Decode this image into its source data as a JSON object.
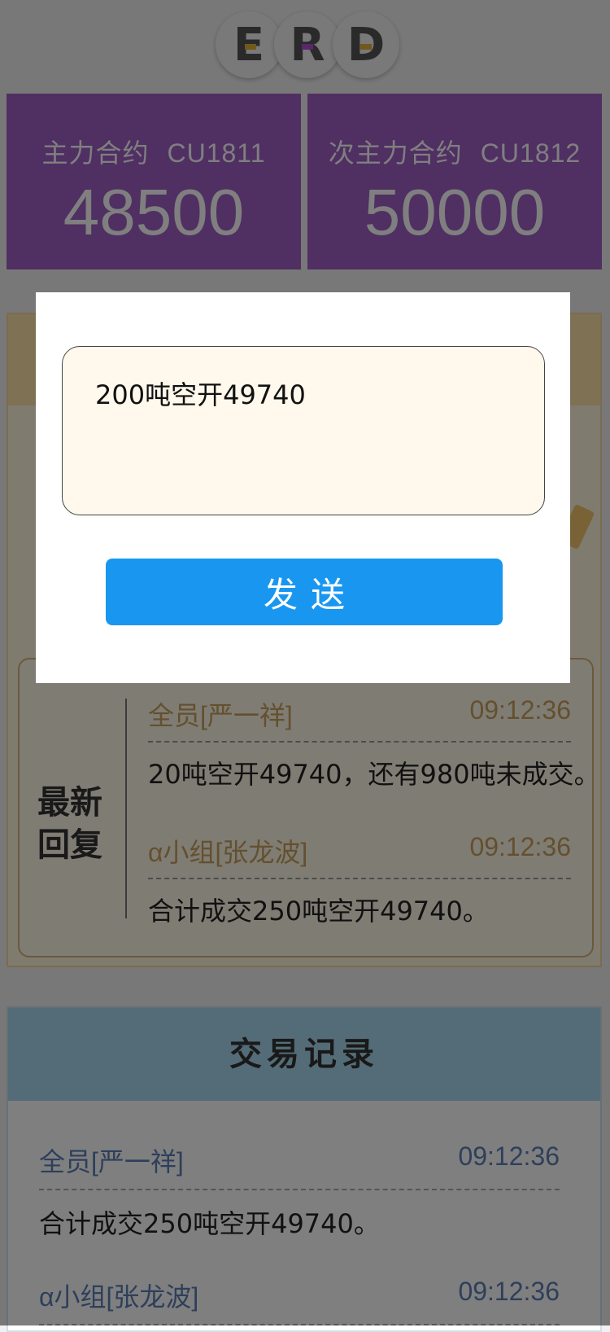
{
  "logo": {
    "letters": [
      "E",
      "R",
      "D"
    ]
  },
  "prices": {
    "main": {
      "label": "主力合约",
      "code": "CU1811",
      "value": "48500"
    },
    "secondary": {
      "label": "次主力合约",
      "code": "CU1812",
      "value": "50000"
    }
  },
  "replies": {
    "title": "最新回复",
    "items": [
      {
        "sender": "全员[严一祥]",
        "time": "09:12:36",
        "message": "20吨空开49740，还有980吨未成交。"
      },
      {
        "sender": "α小组[张龙波]",
        "time": "09:12:36",
        "message": "合计成交250吨空开49740。"
      }
    ]
  },
  "trade_log": {
    "title": "交易记录",
    "items": [
      {
        "sender": "全员[严一祥]",
        "time": "09:12:36",
        "message": "合计成交250吨空开49740。"
      },
      {
        "sender": "α小组[张龙波]",
        "time": "09:12:36",
        "message": ""
      }
    ]
  },
  "dialog": {
    "input_value": "200吨空开49740",
    "send_label": "发送"
  },
  "colors": {
    "price_card": "#a05ec6",
    "send_button": "#1997f0",
    "reply_sender": "#c9a15c",
    "trade_sender": "#5d7fb6"
  }
}
